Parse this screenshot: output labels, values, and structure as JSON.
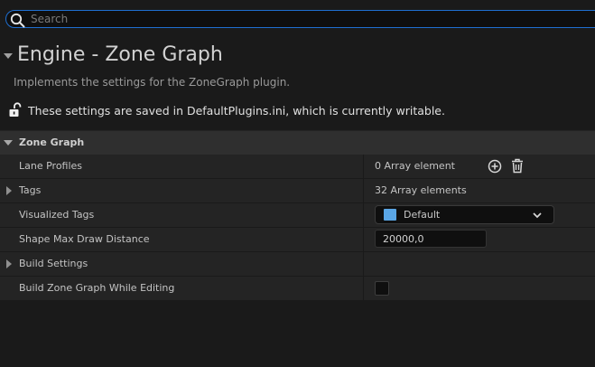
{
  "search": {
    "placeholder": "Search",
    "value": ""
  },
  "header": {
    "title": "Engine - Zone Graph",
    "description": "Implements the settings for the ZoneGraph plugin.",
    "config_status": "These settings are saved in DefaultPlugins.ini, which is currently writable."
  },
  "category": {
    "label": "Zone Graph"
  },
  "properties": [
    {
      "label": "Lane Profiles",
      "value": "0 Array element"
    },
    {
      "label": "Tags",
      "value": "32 Array elements"
    },
    {
      "label": "Visualized Tags",
      "value": "Default",
      "swatch_color": "#5aa6e6"
    },
    {
      "label": "Shape Max Draw Distance",
      "value": "20000,0"
    },
    {
      "label": "Build Settings",
      "value": ""
    },
    {
      "label": "Build Zone Graph While Editing",
      "checked": false
    }
  ],
  "icons": {
    "search": "search-icon",
    "lock": "unlocked-icon",
    "add": "add-circle-icon",
    "delete": "trash-icon",
    "dropdown": "chevron-down-icon"
  },
  "colors": {
    "background": "#1a1a1a",
    "row_background": "#242424",
    "category_background": "#2f2f2f",
    "search_border": "#1f6fd1",
    "tag_swatch": "#5aa6e6"
  }
}
